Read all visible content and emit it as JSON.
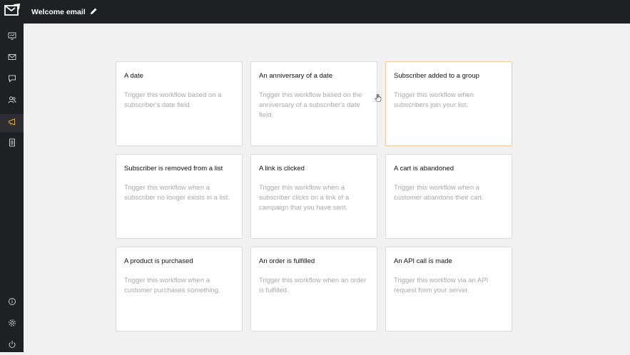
{
  "app": {
    "workflow_title": "Welcome email"
  },
  "sidebar": {
    "items": [
      {
        "icon": "monitor-icon",
        "active": false
      },
      {
        "icon": "envelope-icon",
        "active": false
      },
      {
        "icon": "chat-bubble-icon",
        "active": false
      },
      {
        "icon": "users-icon",
        "active": false
      },
      {
        "icon": "megaphone-icon",
        "active": true
      },
      {
        "icon": "document-list-icon",
        "active": false
      }
    ],
    "bottom_items": [
      {
        "icon": "info-icon"
      },
      {
        "icon": "gear-icon"
      },
      {
        "icon": "power-icon"
      }
    ]
  },
  "triggers": [
    {
      "title": "A date",
      "description": "Trigger this workflow based on a subscriber's date field."
    },
    {
      "title": "An anniversary of a date",
      "description": "Trigger this workflow based on the anniversary of a subscriber's date field."
    },
    {
      "title": "Subscriber added to a group",
      "description": "Trigger this workflow when subscribers join your list."
    },
    {
      "title": "Subscriber is removed from a list",
      "description": "Trigger this workflow when a subscriber no longer exists in a list."
    },
    {
      "title": "A link is clicked",
      "description": "Trigger this workflow when a subscriber clicks on a link of a campaign that you have sent."
    },
    {
      "title": "A cart is abandoned",
      "description": "Trigger this workflow when a customer abandons their cart."
    },
    {
      "title": "A product is purchased",
      "description": "Trigger this workflow when a customer purchases something."
    },
    {
      "title": "An order is fulfilled",
      "description": "Trigger this workflow when an order is fulfilled."
    },
    {
      "title": "An API call is made",
      "description": "Trigger this workflow via an API request form your server."
    }
  ],
  "colors": {
    "sidebar_bg": "#1f2024",
    "accent": "#e8a33d",
    "selected_border": "#f1c79c"
  }
}
